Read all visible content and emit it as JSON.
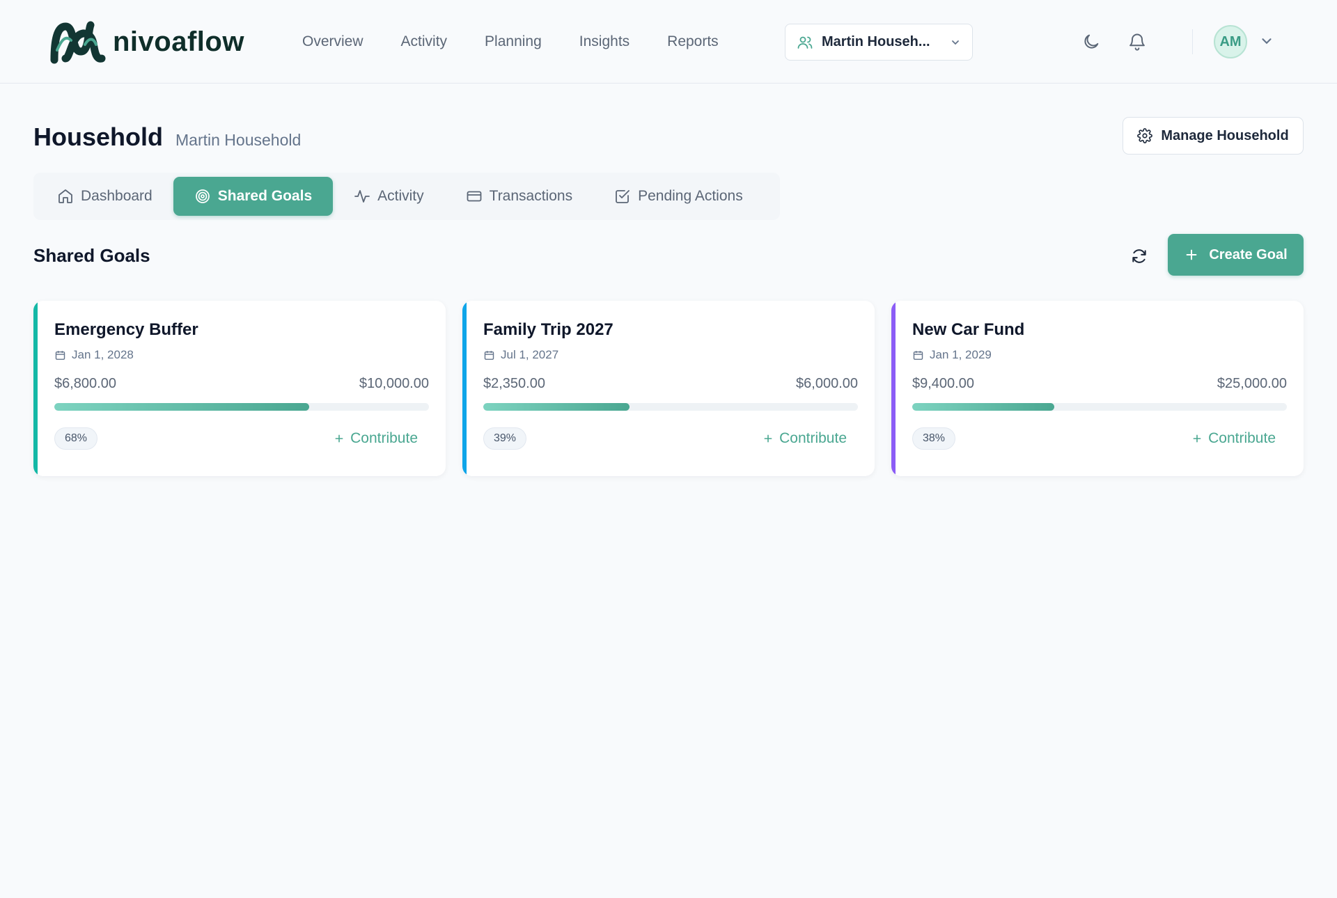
{
  "brand": {
    "name": "nivoaflow"
  },
  "nav": {
    "items": [
      "Overview",
      "Activity",
      "Planning",
      "Insights",
      "Reports"
    ]
  },
  "household_switcher": {
    "label": "Martin Househ...",
    "icon": "users-icon"
  },
  "header_icons": {
    "theme": "moon-icon",
    "notifications": "bell-icon"
  },
  "user": {
    "initials": "AM"
  },
  "page": {
    "title": "Household",
    "subtitle": "Martin Household",
    "manage_label": "Manage Household"
  },
  "tabs": [
    {
      "label": "Dashboard",
      "icon": "home-icon",
      "active": false
    },
    {
      "label": "Shared Goals",
      "icon": "target-icon",
      "active": true
    },
    {
      "label": "Activity",
      "icon": "activity-icon",
      "active": false
    },
    {
      "label": "Transactions",
      "icon": "credit-card-icon",
      "active": false
    },
    {
      "label": "Pending Actions",
      "icon": "checkbox-icon",
      "active": false
    }
  ],
  "section": {
    "title": "Shared Goals",
    "create_label": "Create Goal"
  },
  "goals": [
    {
      "title": "Emergency Buffer",
      "date": "Jan 1, 2028",
      "current": "$6,800.00",
      "target": "$10,000.00",
      "percent_label": "68%",
      "progress": 0.68,
      "accent": "#14b8a6",
      "contribute_label": "Contribute"
    },
    {
      "title": "Family Trip 2027",
      "date": "Jul 1, 2027",
      "current": "$2,350.00",
      "target": "$6,000.00",
      "percent_label": "39%",
      "progress": 0.39,
      "accent": "#0ea5e9",
      "contribute_label": "Contribute"
    },
    {
      "title": "New Car Fund",
      "date": "Jan 1, 2029",
      "current": "$9,400.00",
      "target": "$25,000.00",
      "percent_label": "38%",
      "progress": 0.38,
      "accent": "#8b5cf6",
      "contribute_label": "Contribute"
    }
  ],
  "colors": {
    "primary": "#4aa791",
    "muted_text": "#64748b"
  }
}
